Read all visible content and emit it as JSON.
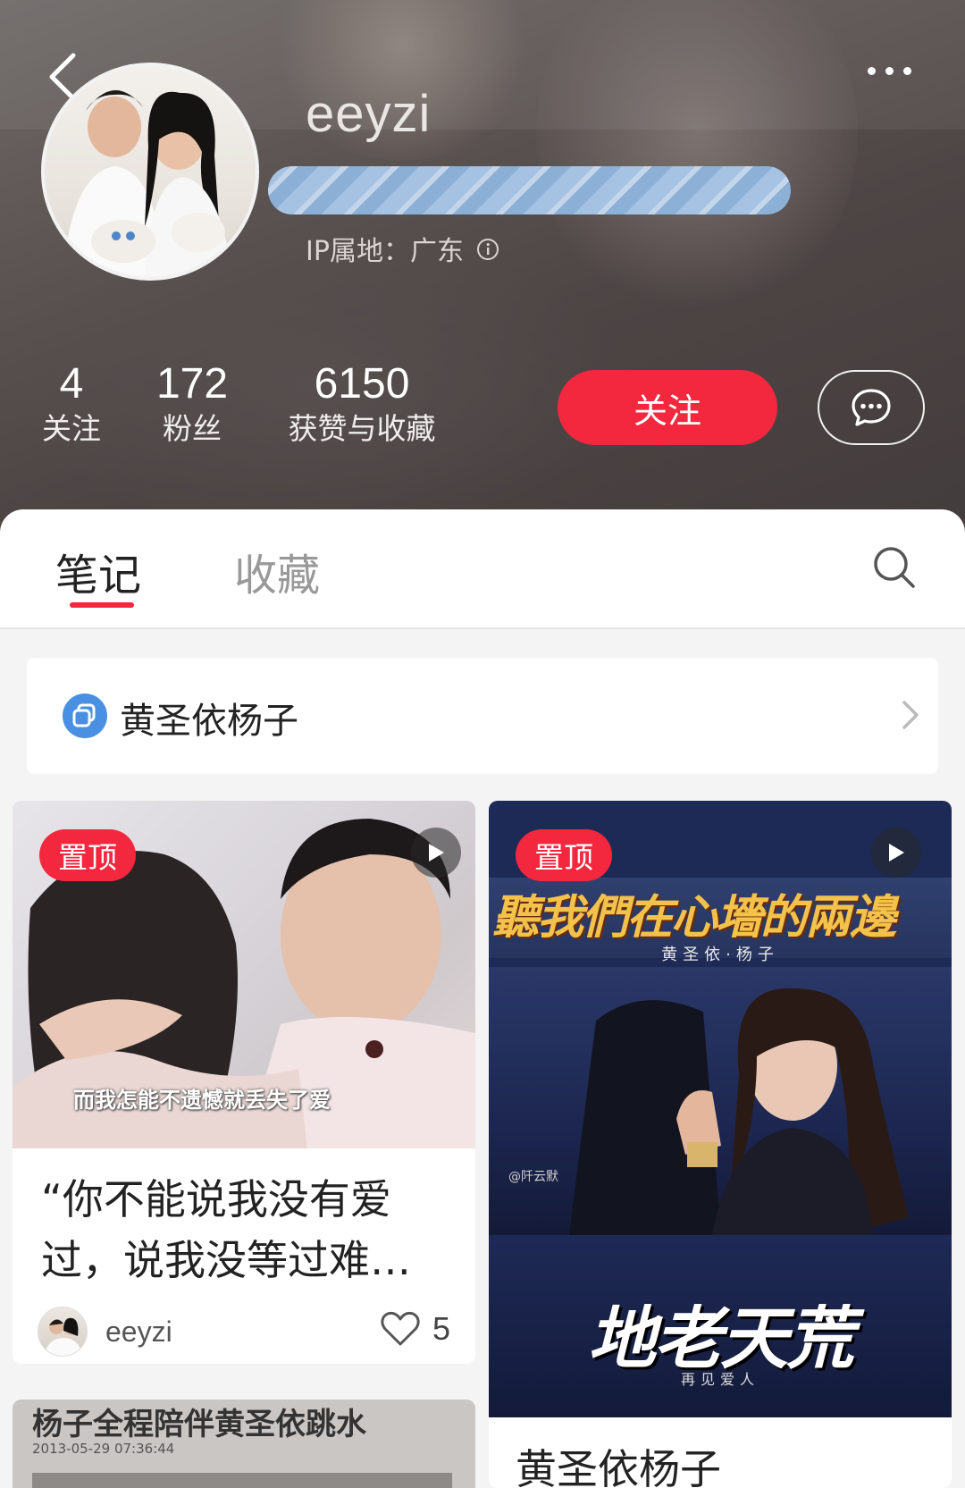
{
  "profile": {
    "username": "eeyzi",
    "ip_location": "IP属地：广东",
    "stats": [
      {
        "value": "4",
        "label": "关注"
      },
      {
        "value": "172",
        "label": "粉丝"
      },
      {
        "value": "6150",
        "label": "获赞与收藏"
      }
    ],
    "follow_label": "关注",
    "icons": {
      "back": "back-arrow-icon",
      "more": "more-dots-icon",
      "message": "chat-bubble-icon",
      "info": "info-icon"
    }
  },
  "tabs": {
    "items": [
      {
        "label": "笔记"
      },
      {
        "label": "收藏"
      }
    ],
    "active": "笔记"
  },
  "collection": {
    "label": "黄圣依杨子"
  },
  "notes": [
    {
      "pinned_label": "置顶",
      "subtitle": "而我怎能不遗憾就丢失了爱",
      "title": "“你不能说我没有爱过，说我没等过难…",
      "author": "eeyzi",
      "likes": "5"
    },
    {
      "pinned_label": "置顶",
      "banner": "聽我們在心墻的兩邊",
      "banner_sub": "黄圣依·杨子",
      "watermark": "@阡云默",
      "big_title": "地老天荒",
      "big_sub": "再见爱人",
      "title": "黄圣依杨子"
    },
    {
      "title": "杨子全程陪伴黄圣依跳水",
      "date": "2013-05-29 07:36:44"
    }
  ],
  "colors": {
    "accent": "#f3283e",
    "header_bg": "#4d4544",
    "collection_icon": "#4a90e2"
  }
}
